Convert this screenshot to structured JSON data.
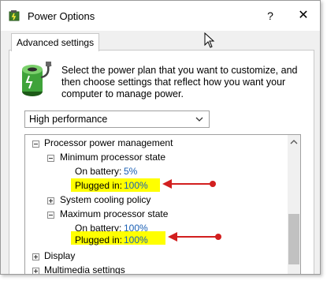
{
  "window": {
    "title": "Power Options",
    "help_label": "?",
    "close_label": "✕"
  },
  "tab": {
    "label": "Advanced settings"
  },
  "description": "Select the power plan that you want to customize, and then choose settings that reflect how you want your computer to manage power.",
  "plan_select": {
    "value": "High performance"
  },
  "tree": {
    "processor": {
      "label": "Processor power management"
    },
    "min_state": {
      "label": "Minimum processor state",
      "on_battery_label": "On battery:",
      "on_battery_value": "5%",
      "plugged_in_label": "Plugged in:",
      "plugged_in_value": "100%"
    },
    "cooling": {
      "label": "System cooling policy"
    },
    "max_state": {
      "label": "Maximum processor state",
      "on_battery_label": "On battery:",
      "on_battery_value": "100%",
      "plugged_in_label": "Plugged in:",
      "plugged_in_value": "100%"
    },
    "display": {
      "label": "Display"
    },
    "multimedia": {
      "label": "Multimedia settings"
    }
  },
  "colors": {
    "highlight": "#ffff00",
    "annotation_arrow": "#d21f1f",
    "value_text": "#1a5fb4"
  }
}
